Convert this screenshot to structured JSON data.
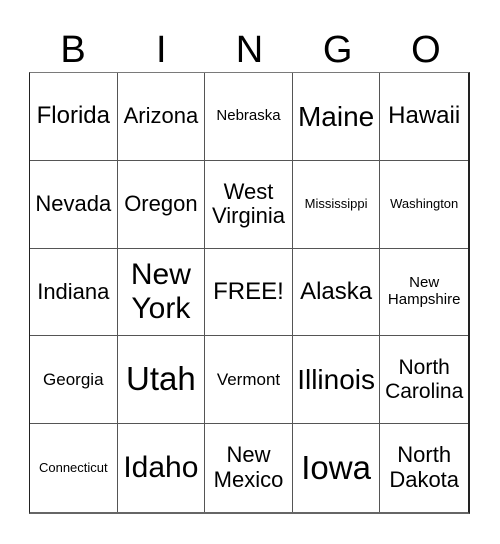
{
  "header": [
    "B",
    "I",
    "N",
    "G",
    "O"
  ],
  "cells": [
    {
      "text": "Florida",
      "size": "s24"
    },
    {
      "text": "Arizona",
      "size": "s22"
    },
    {
      "text": "Nebraska",
      "size": "s15"
    },
    {
      "text": "Maine",
      "size": "s28"
    },
    {
      "text": "Hawaii",
      "size": "s24"
    },
    {
      "text": "Nevada",
      "size": "s22"
    },
    {
      "text": "Oregon",
      "size": "s22"
    },
    {
      "text": "West Virginia",
      "size": "s22"
    },
    {
      "text": "Mississippi",
      "size": "s13"
    },
    {
      "text": "Washington",
      "size": "s13"
    },
    {
      "text": "Indiana",
      "size": "s22"
    },
    {
      "text": "New York",
      "size": "s30"
    },
    {
      "text": "FREE!",
      "size": "s24"
    },
    {
      "text": "Alaska",
      "size": "s24"
    },
    {
      "text": "New Hampshire",
      "size": "s15"
    },
    {
      "text": "Georgia",
      "size": "s17"
    },
    {
      "text": "Utah",
      "size": "s33"
    },
    {
      "text": "Vermont",
      "size": "s17"
    },
    {
      "text": "Illinois",
      "size": "s28"
    },
    {
      "text": "North Carolina",
      "size": "s21"
    },
    {
      "text": "Connecticut",
      "size": "s13"
    },
    {
      "text": "Idaho",
      "size": "s30"
    },
    {
      "text": "New Mexico",
      "size": "s22"
    },
    {
      "text": "Iowa",
      "size": "s33"
    },
    {
      "text": "North Dakota",
      "size": "s22"
    }
  ]
}
